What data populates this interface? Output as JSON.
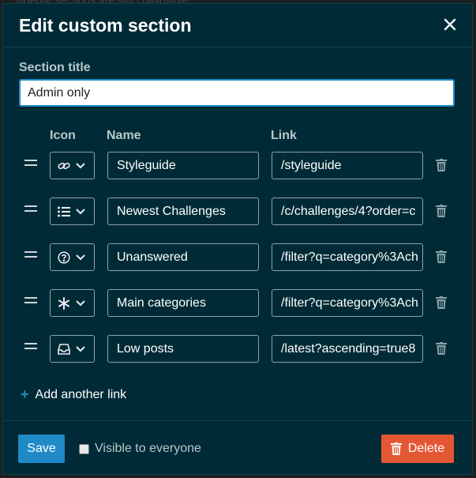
{
  "background_text": "sidebar sections are still collapsible",
  "modal": {
    "title": "Edit custom section"
  },
  "section_title": {
    "label": "Section title",
    "value": "Admin only"
  },
  "columns": {
    "icon": "Icon",
    "name": "Name",
    "link": "Link"
  },
  "links": [
    {
      "icon": "link-icon",
      "name": "Styleguide",
      "link": "/styleguide"
    },
    {
      "icon": "list-icon",
      "name": "Newest Challenges",
      "link": "/c/challenges/4?order=c"
    },
    {
      "icon": "question-circle-icon",
      "name": "Unanswered",
      "link": "/filter?q=category%3Ach"
    },
    {
      "icon": "asterisk-icon",
      "name": "Main categories",
      "link": "/filter?q=category%3Ach"
    },
    {
      "icon": "inbox-icon",
      "name": "Low posts",
      "link": "/latest?ascending=true8"
    }
  ],
  "add_link_label": "Add another link",
  "footer": {
    "save_label": "Save",
    "visible_label": "Visible to everyone",
    "delete_label": "Delete"
  },
  "colors": {
    "modal_bg": "#002b36",
    "primary": "#1f8ac6",
    "danger": "#e45735"
  }
}
